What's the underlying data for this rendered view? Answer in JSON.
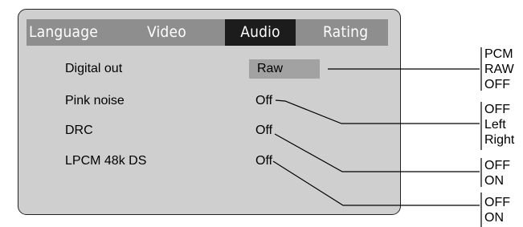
{
  "tabs": [
    {
      "label": "Language",
      "active": false
    },
    {
      "label": "Video",
      "active": false
    },
    {
      "label": "Audio",
      "active": true
    },
    {
      "label": "Rating",
      "active": false
    }
  ],
  "settings": [
    {
      "label": "Digital out",
      "value": "Raw",
      "options": [
        "PCM",
        "RAW",
        "OFF"
      ]
    },
    {
      "label": "Pink noise",
      "value": "Off",
      "options": [
        "OFF",
        "Left",
        "Right"
      ]
    },
    {
      "label": "DRC",
      "value": "Off",
      "options": [
        "OFF",
        "ON"
      ]
    },
    {
      "label": "LPCM 48k DS",
      "value": "Off",
      "options": [
        "OFF",
        "ON"
      ]
    }
  ],
  "colors": {
    "panel": "#cfcfcf",
    "tabbar": "#8e8e8e",
    "tab_active": "#1c1c1c",
    "selected_value": "#a2a2a2"
  }
}
